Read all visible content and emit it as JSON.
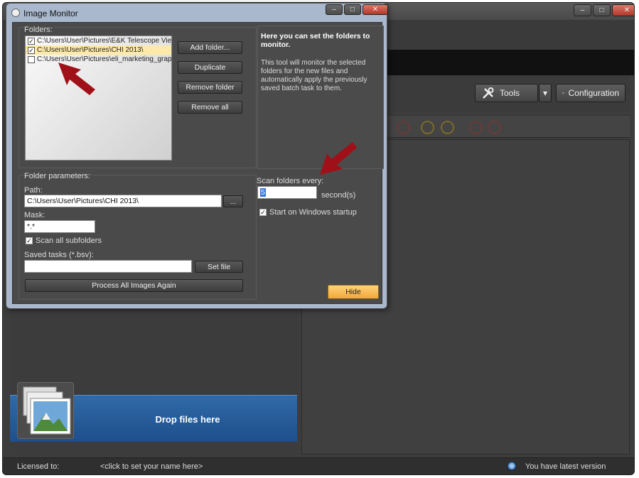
{
  "main": {
    "tools_label": "Tools",
    "configuration_label": "Configuration",
    "drop_label": "Drop files here",
    "status": {
      "licensed_label": "Licensed to:",
      "name_link": "<click to set your name here>",
      "version_text": "You have latest version"
    }
  },
  "dialog": {
    "title": "Image Monitor",
    "folders_label": "Folders:",
    "folders": [
      {
        "path": "C:\\Users\\User\\Pictures\\E&K Telescope View",
        "checked": true,
        "selected": false
      },
      {
        "path": "C:\\Users\\User\\Pictures\\CHI 2013\\",
        "checked": true,
        "selected": true
      },
      {
        "path": "C:\\Users\\User\\Pictures\\eli_marketing_graphic",
        "checked": false,
        "selected": false
      }
    ],
    "buttons": {
      "add_folder": "Add folder...",
      "duplicate": "Duplicate",
      "remove_folder": "Remove folder",
      "remove_all": "Remove all",
      "browse": "...",
      "set_file": "Set file",
      "process_all": "Process All Images Again",
      "hide": "Hide"
    },
    "info_title": "Here you can set the folders to monitor.",
    "info_text": "This tool will monitor the selected folders for the new files and automatically apply the previously saved batch task to them.",
    "params_label": "Folder parameters:",
    "path_label": "Path:",
    "path_value": "C:\\Users\\User\\Pictures\\CHI 2013\\",
    "mask_label": "Mask:",
    "mask_value": "*.*",
    "scan_subfolders_label": "Scan all subfolders",
    "scan_subfolders_checked": true,
    "saved_tasks_label": "Saved tasks (*.bsv):",
    "saved_tasks_value": "",
    "scan_every_label": "Scan folders every:",
    "scan_every_value": "5",
    "seconds_label": "second(s)",
    "startup_label": "Start on Windows startup",
    "startup_checked": true
  },
  "colors": {
    "accent": "#f2a83a",
    "arrow": "#a01018",
    "drop_zone": "#2a5d9a"
  }
}
